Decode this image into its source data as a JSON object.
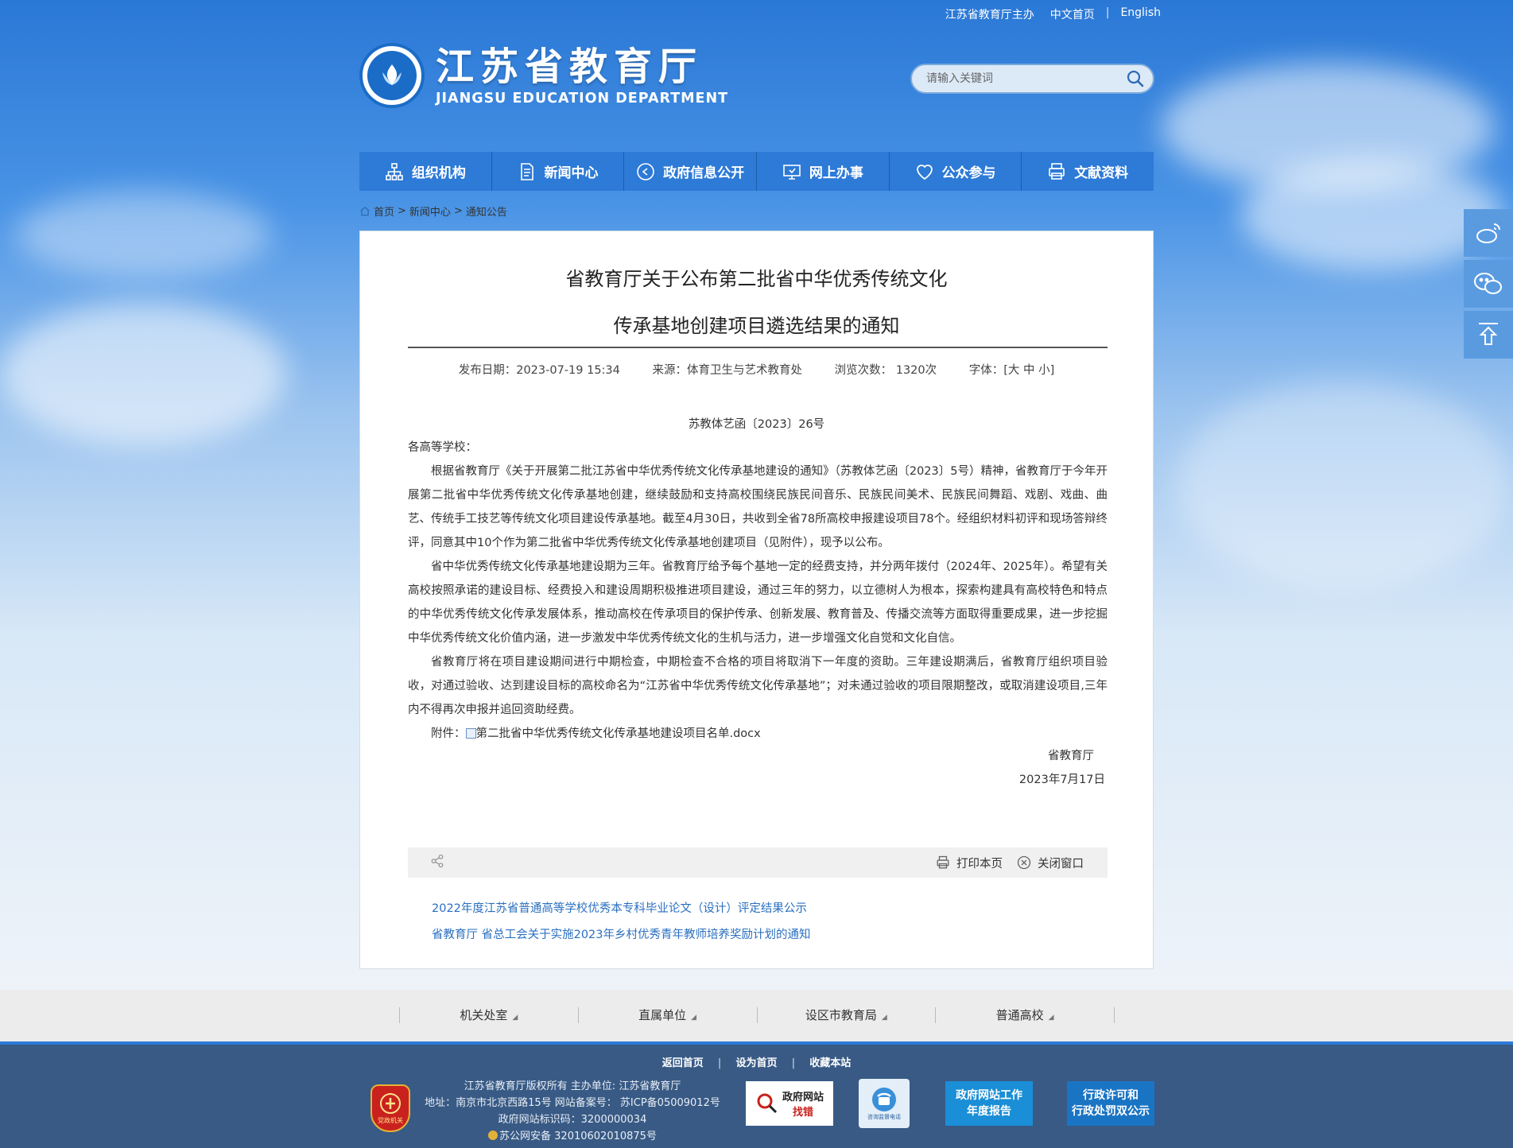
{
  "topbar": {
    "host": "江苏省教育厅主办",
    "cn_home": "中文首页",
    "separator": "|",
    "english": "English"
  },
  "logo": {
    "name_cn": "江苏省教育厅",
    "name_en": "JIANGSU EDUCATION DEPARTMENT"
  },
  "search": {
    "placeholder": "请输入关键词"
  },
  "nav": [
    {
      "label": "组织机构",
      "icon": "org-chart-icon"
    },
    {
      "label": "新闻中心",
      "icon": "document-icon"
    },
    {
      "label": "政府信息公开",
      "icon": "compass-icon"
    },
    {
      "label": "网上办事",
      "icon": "monitor-icon"
    },
    {
      "label": "公众参与",
      "icon": "heart-icon"
    },
    {
      "label": "文献资料",
      "icon": "printer-icon"
    }
  ],
  "breadcrumb": {
    "home": "首页",
    "sep1": ">",
    "news": "新闻中心",
    "sep2": ">",
    "notice": "通知公告"
  },
  "article": {
    "title_line1": "省教育厅关于公布第二批省中华优秀传统文化",
    "title_line2": "传承基地创建项目遴选结果的通知",
    "publish_date": "发布日期：2023-07-19 15:34",
    "source": "来源：体育卫生与艺术教育处",
    "views": "浏览次数： 1320次",
    "font_size": "字体：[大 中 小]",
    "doc_no": "苏教体艺函〔2023〕26号",
    "salutation": "各高等学校：",
    "para1": "根据省教育厅《关于开展第二批江苏省中华优秀传统文化传承基地建设的通知》（苏教体艺函〔2023〕5号）精神，省教育厅于今年开展第二批省中华优秀传统文化传承基地创建，继续鼓励和支持高校围绕民族民间音乐、民族民间美术、民族民间舞蹈、戏剧、戏曲、曲艺、传统手工技艺等传统文化项目建设传承基地。截至4月30日，共收到全省78所高校申报建设项目78个。经组织材料初评和现场答辩终评，同意其中10个作为第二批省中华优秀传统文化传承基地创建项目（见附件），现予以公布。",
    "para2": "省中华优秀传统文化传承基地建设期为三年。省教育厅给予每个基地一定的经费支持，并分两年拨付（2024年、2025年）。希望有关高校按照承诺的建设目标、经费投入和建设周期积极推进项目建设，通过三年的努力，以立德树人为根本，探索构建具有高校特色和特点的中华优秀传统文化传承发展体系，推动高校在传承项目的保护传承、创新发展、教育普及、传播交流等方面取得重要成果，进一步挖掘中华优秀传统文化价值内涵，进一步激发中华优秀传统文化的生机与活力，进一步增强文化自觉和文化自信。",
    "para3": "省教育厅将在项目建设期间进行中期检查，中期检查不合格的项目将取消下一年度的资助。三年建设期满后，省教育厅组织项目验收，对通过验收、达到建设目标的高校命名为“江苏省中华优秀传统文化传承基地”；对未通过验收的项目限期整改，或取消建设项目,三年内不得再次申报并追回资助经费。",
    "attach_label": "附件：",
    "attach_file": "第二批省中华优秀传统文化传承基地建设项目名单.docx",
    "signer": "省教育厅",
    "sign_date": "2023年7月17日"
  },
  "toolbar": {
    "print": "打印本页",
    "close": "关闭窗口"
  },
  "related": [
    "2022年度江苏省普通高等学校优秀本专科毕业论文（设计）评定结果公示",
    "省教育厅 省总工会关于实施2023年乡村优秀青年教师培养奖励计划的通知"
  ],
  "footer_links": [
    "机关处室",
    "直属单位",
    "设区市教育局",
    "普通高校"
  ],
  "footer": {
    "nav_back": "返回首页",
    "nav_set": "设为首页",
    "nav_fav": "收藏本站",
    "sep": "|",
    "line1": "江苏省教育厅版权所有 主办单位: 江苏省教育厅",
    "line2": "地址：南京市北京西路15号 网站备案号： 苏ICP备05009012号",
    "line3": "政府网站标识码：3200000034",
    "line4": "苏公网安备 32010602010875号",
    "emblem_text": "党政机关",
    "box1_a": "政府网站",
    "box1_b": "找错",
    "box2": "咨询监督电话",
    "box3_a": "政府网站工作",
    "box3_b": "年度报告",
    "box4_a": "行政许可和",
    "box4_b": "行政处罚双公示"
  },
  "colors": {
    "nav_bg": "#2d7ad7",
    "footer_bg": "#385a85",
    "link": "#2a6fc0"
  }
}
